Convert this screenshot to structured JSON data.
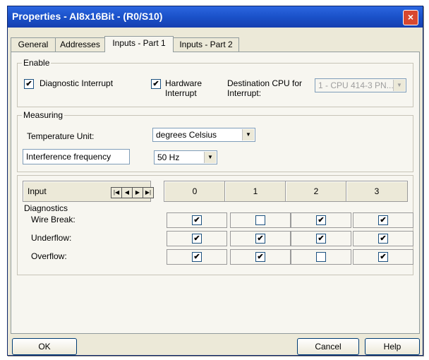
{
  "window": {
    "title": "Properties - AI8x16Bit - (R0/S10)",
    "close_glyph": "×"
  },
  "tabs": [
    {
      "label": "General"
    },
    {
      "label": "Addresses"
    },
    {
      "label": "Inputs - Part 1"
    },
    {
      "label": "Inputs - Part 2"
    }
  ],
  "enable": {
    "legend": "Enable",
    "diagnostic_interrupt": {
      "label": "Diagnostic Interrupt",
      "checked": true
    },
    "hardware_interrupt": {
      "label_line1": "Hardware",
      "label_line2": "Interrupt",
      "checked": true
    },
    "destination_cpu": {
      "label_line1": "Destination CPU for",
      "label_line2": "Interrupt:",
      "value": "1 - CPU 414-3 PN..."
    }
  },
  "measuring": {
    "legend": "Measuring",
    "temperature_unit": {
      "label": "Temperature Unit:",
      "value": "degrees Celsius"
    },
    "interference": {
      "label": "Interference frequency",
      "value": "50 Hz"
    }
  },
  "inputs_table": {
    "header_label": "Input",
    "channels": [
      "0",
      "1",
      "2",
      "3"
    ],
    "diagnostics_label": "Diagnostics",
    "rows": [
      {
        "label": "Wire Break:",
        "checked": [
          true,
          false,
          true,
          true
        ]
      },
      {
        "label": "Underflow:",
        "checked": [
          true,
          true,
          true,
          true
        ]
      },
      {
        "label": "Overflow:",
        "checked": [
          true,
          true,
          false,
          true
        ]
      }
    ],
    "check_glyph": "✔"
  },
  "buttons": {
    "ok": "OK",
    "cancel": "Cancel",
    "help": "Help"
  },
  "colors": {
    "titlebar": "#1a51c9",
    "dialog_bg": "#ece9d8",
    "close_button": "#d8482f"
  }
}
